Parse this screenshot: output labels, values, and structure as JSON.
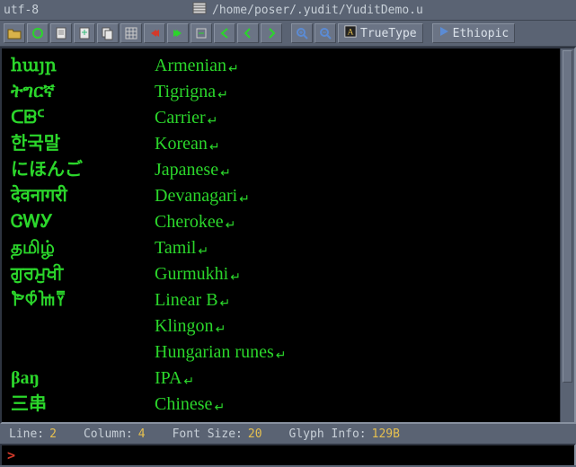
{
  "title": {
    "encoding": "utf-8",
    "path": "/home/poser/.yudit/YuditDemo.u"
  },
  "toolbar": {
    "font_label": "TrueType",
    "script_label": "Ethiopic"
  },
  "rows": [
    {
      "native": "հայր",
      "lang": "Armenian"
    },
    {
      "native": "ትግርኛ",
      "lang": "Tigrigna"
    },
    {
      "native": "ᑕᗸᑦ",
      "lang": "Carrier"
    },
    {
      "native": "한국말",
      "lang": "Korean"
    },
    {
      "native": "にほんご",
      "lang": "Japanese"
    },
    {
      "native": "देवनागरी",
      "lang": "Devanagari"
    },
    {
      "native": "ᏣᎳᎩ",
      "lang": "Cherokee"
    },
    {
      "native": "தமிழ்",
      "lang": "Tamil"
    },
    {
      "native": "ਗੁਰਮੁਖੀ",
      "lang": "Gurmukhi"
    },
    {
      "native": "𐁂𐀶𐀎𐀙",
      "lang": "Linear B"
    },
    {
      "native": "",
      "lang": "Klingon"
    },
    {
      "native": "",
      "lang": "Hungarian runes"
    },
    {
      "native": "βaŋ",
      "lang": "IPA"
    },
    {
      "native": "三串",
      "lang": "Chinese"
    }
  ],
  "status": {
    "line_label": "Line:",
    "line_value": "2",
    "col_label": "Column:",
    "col_value": "4",
    "font_label": "Font Size:",
    "font_value": "20",
    "glyph_label": "Glyph Info:",
    "glyph_value": "129B"
  },
  "cmd": {
    "prompt": ">"
  }
}
